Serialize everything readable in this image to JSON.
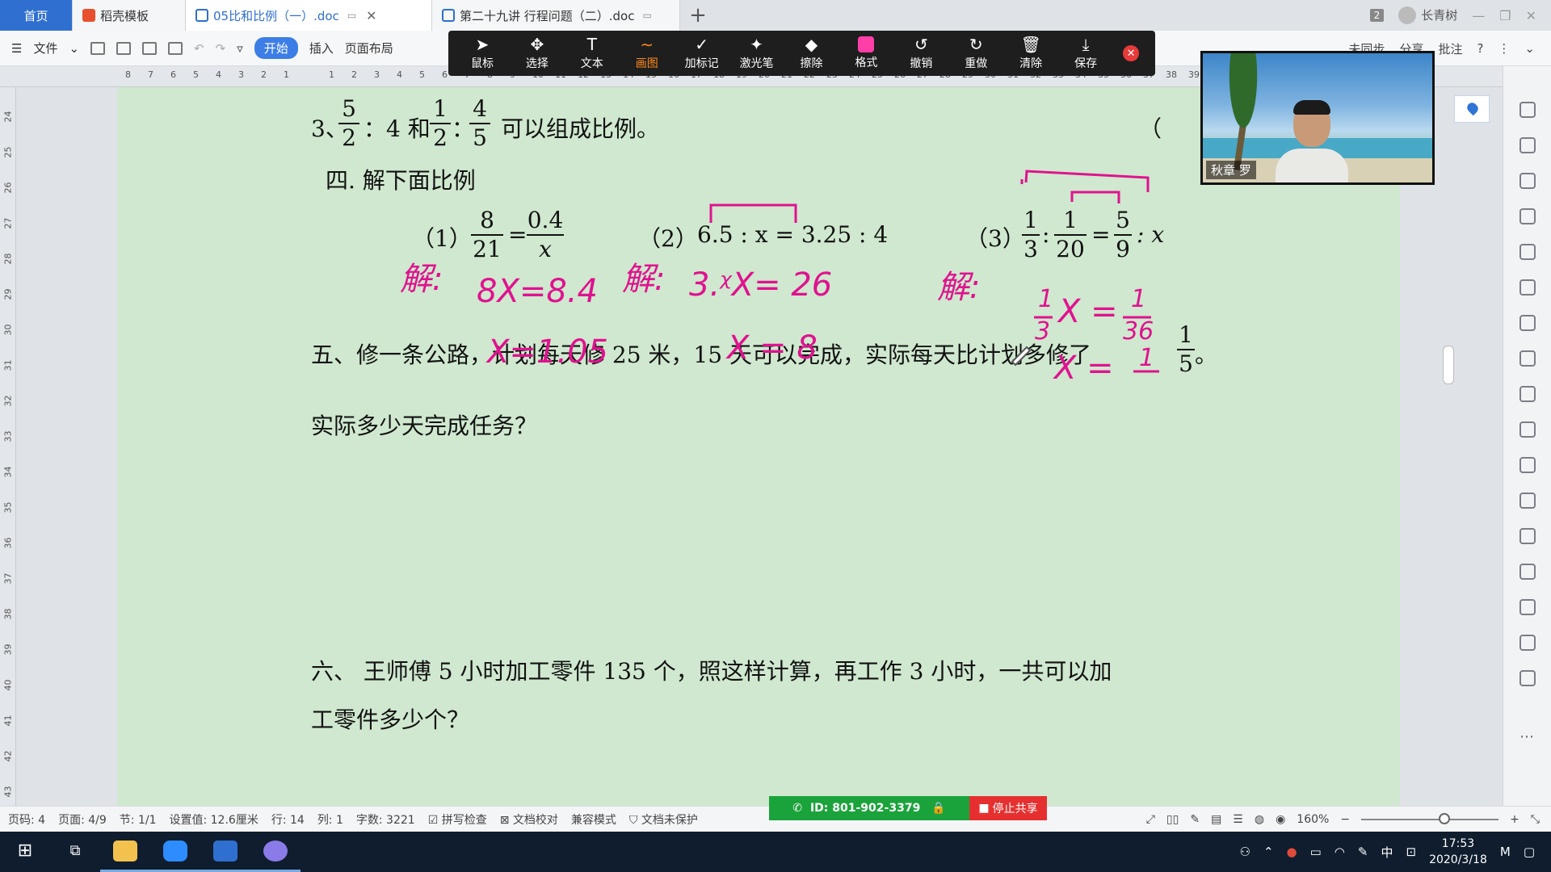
{
  "tabs": {
    "home": "首页",
    "daoke": "稻壳模板",
    "doc1": "05比和比例（一）.doc",
    "doc2": "第二十九讲 行程问题（二）.doc"
  },
  "titlebar": {
    "badge": "2",
    "user": "长青树"
  },
  "ribbon": {
    "file": "文件",
    "start": "开始",
    "insert": "插入",
    "layout": "页面布局",
    "sync": "未同步",
    "share": "分享",
    "comment": "批注"
  },
  "pen_toolbar": {
    "items": [
      {
        "label": "鼠标",
        "icon": "cursor-icon"
      },
      {
        "label": "选择",
        "icon": "move-icon"
      },
      {
        "label": "文本",
        "icon": "text-icon"
      },
      {
        "label": "画图",
        "icon": "draw-icon",
        "active": true
      },
      {
        "label": "加标记",
        "icon": "check-icon"
      },
      {
        "label": "激光笔",
        "icon": "laser-icon"
      },
      {
        "label": "擦除",
        "icon": "eraser-icon"
      },
      {
        "label": "格式",
        "icon": "color-swatch-icon"
      },
      {
        "label": "撤销",
        "icon": "undo-icon"
      },
      {
        "label": "重做",
        "icon": "redo-icon"
      },
      {
        "label": "清除",
        "icon": "trash-icon"
      },
      {
        "label": "保存",
        "icon": "save-icon"
      }
    ],
    "active_color": "#ff3fa8"
  },
  "ruler_h": [
    "8",
    "7",
    "6",
    "5",
    "4",
    "3",
    "2",
    "1",
    "",
    "1",
    "2",
    "3",
    "4",
    "5",
    "6",
    "7",
    "8",
    "9",
    "10",
    "11",
    "12",
    "13",
    "14",
    "15",
    "16",
    "17",
    "18",
    "19",
    "20",
    "21",
    "22",
    "23",
    "24",
    "25",
    "26",
    "27",
    "28",
    "29",
    "30",
    "31",
    "32",
    "33",
    "34",
    "35",
    "36",
    "37",
    "38",
    "39"
  ],
  "ruler_v": [
    "24",
    "25",
    "26",
    "27",
    "28",
    "29",
    "30",
    "31",
    "32",
    "33",
    "34",
    "35",
    "36",
    "37",
    "38",
    "39",
    "40",
    "41",
    "42",
    "43"
  ],
  "doc": {
    "q3_prefix": "3、",
    "q3_f1": {
      "n": "5",
      "d": "2"
    },
    "q3_mid1": "：4 和",
    "q3_f2": {
      "n": "1",
      "d": "2"
    },
    "q3_colon": "：",
    "q3_f3": {
      "n": "4",
      "d": "5"
    },
    "q3_text": "可以组成比例。",
    "q3_paren": "（",
    "sec4": "四. 解下面比例",
    "p1_label": "（1）",
    "p1_f1": {
      "n": "8",
      "d": "21"
    },
    "p1_eq": "=",
    "p1_f2": {
      "n": "0.4",
      "d": "x"
    },
    "p2_label": "（2）",
    "p2_expr": "6.5 : x = 3.25 : 4",
    "p3_label": "（3）",
    "p3_f1": {
      "n": "1",
      "d": "3"
    },
    "p3_colon": ":",
    "p3_f2": {
      "n": "1",
      "d": "20"
    },
    "p3_eq": "=",
    "p3_f3": {
      "n": "5",
      "d": "9"
    },
    "p3_tail": ": x",
    "sec5_line1": "五、修一条公路，计划每天修 25 米，15 天可以完成，实际每天比计划多修了",
    "sec5_frac": {
      "n": "1",
      "d": "5"
    },
    "sec5_end": "。",
    "sec5_line2": "实际多少天完成任务？",
    "sec6_line1": "六、 王师傅 5 小时加工零件 135 个，照这样计算，再工作 3 小时，一共可以加",
    "sec6_line2": "工零件多少个？"
  },
  "handwriting": {
    "h1_jie": "解:",
    "h1_eq1": "8X=8.4",
    "h1_eq2": "X=1.05",
    "h2_jie": "解:",
    "h2_eq1": "3.ᵡX= 26",
    "h2_eq2": "X = 8",
    "h3_jie": "解:",
    "h3_eq1_a": "1",
    "h3_eq1_b": "3",
    "h3_eq1_x": "X =",
    "h3_eq1_c": "1",
    "h3_eq1_d": "36",
    "h3_eq2": "X =",
    "h3_eq2_n": "1",
    "ink_color": "#e0128f"
  },
  "webcam": {
    "caption": "秋章 罗"
  },
  "statusbar": {
    "page_code": "页码: 4",
    "page": "页面: 4/9",
    "section": "节: 1/1",
    "setting": "设置值: 12.6厘米",
    "row": "行: 14",
    "col": "列: 1",
    "words": "字数: 3221",
    "spell": "拼写检查",
    "proof": "文档校对",
    "compat": "兼容模式",
    "protect": "文档未保护",
    "zoom": "160%",
    "zoom_fraction": 0.6
  },
  "share_bar": {
    "id": "ID: 801-902-3379",
    "stop": "停止共享"
  },
  "taskbar": {
    "ime": "中",
    "time": "17:53",
    "date": "2020/3/18"
  }
}
